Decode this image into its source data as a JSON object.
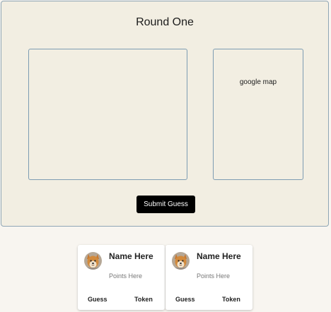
{
  "round": {
    "title": "Round One",
    "map_label": "google map",
    "submit_label": "Submit Guess"
  },
  "players": [
    {
      "name": "Name Here",
      "points": "Points Here",
      "guess_label": "Guess",
      "token_label": "Token"
    },
    {
      "name": "Name Here",
      "points": "Points Here",
      "guess_label": "Guess",
      "token_label": "Token"
    }
  ],
  "colors": {
    "page_background": "#f8f5f0",
    "panel_background": "#f2eee2",
    "box_border": "#7d9cb2",
    "button_background": "#000000",
    "button_text": "#ffffff"
  },
  "icons": {
    "avatar": "shiba-dog-avatar-icon"
  }
}
